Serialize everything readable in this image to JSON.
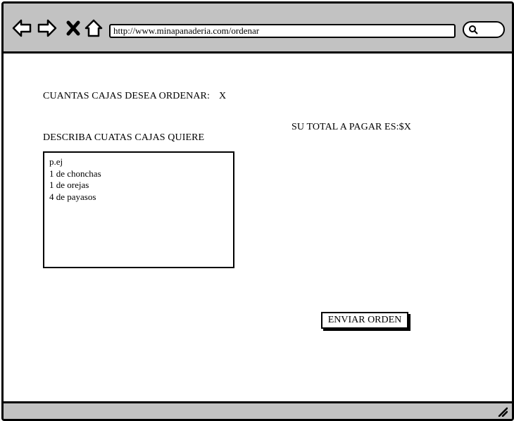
{
  "browser": {
    "url": "http://www.minapanaderia.com/ordenar",
    "icons": [
      "back-arrow-icon",
      "forward-arrow-icon",
      "close-icon",
      "home-icon",
      "search-icon",
      "resize-grip-icon"
    ]
  },
  "form": {
    "boxes_label": "CUANTAS CAJAS DESEA ORDENAR:",
    "boxes_value": "X",
    "describe_label": "DESCRIBA CUATAS CAJAS QUIERE",
    "textarea_lines": [
      "p.ej",
      "1 de chonchas",
      "1 de orejas",
      "4 de payasos"
    ],
    "total_label": "SU TOTAL A PAGAR ES:$X",
    "submit_label": "ENVIAR ORDEN"
  },
  "colors": {
    "chrome": "#c2c2c2",
    "border": "#000000",
    "page": "#ffffff"
  }
}
